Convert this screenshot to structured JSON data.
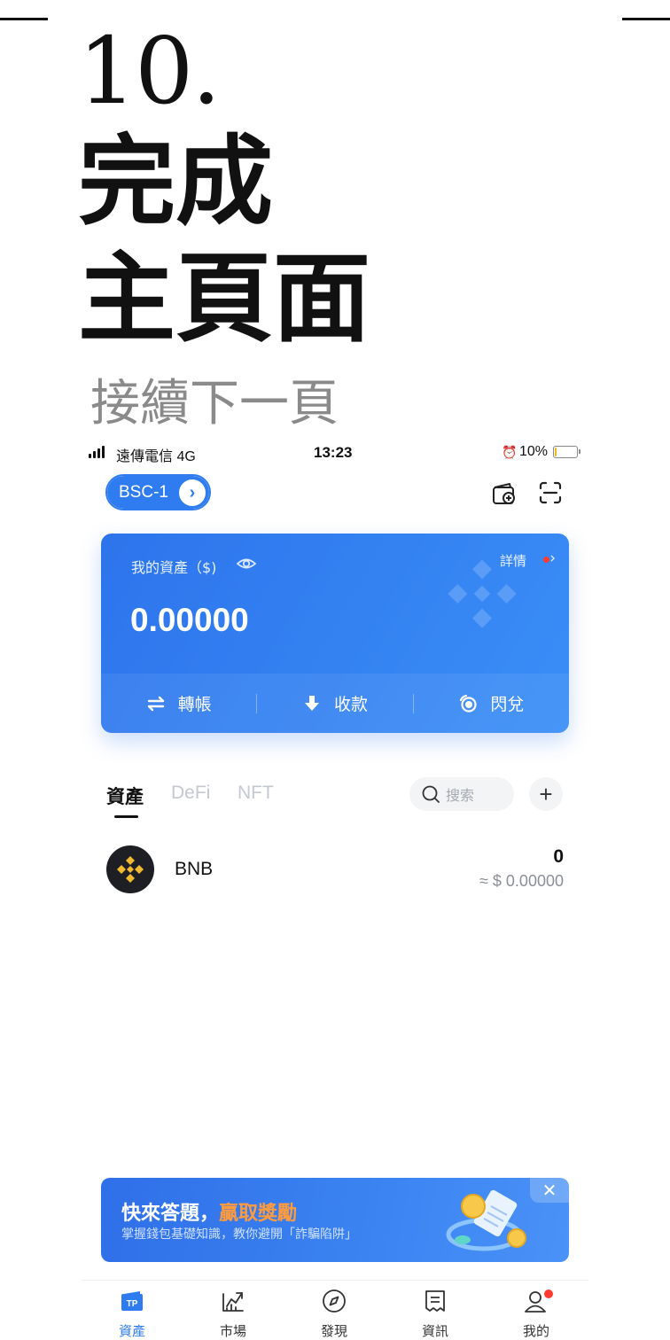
{
  "slide": {
    "step_number": "10.",
    "title_line_1": "完成",
    "title_line_2": "主頁面",
    "continue_note": "接續下一頁"
  },
  "status_bar": {
    "carrier": "遠傳電信  4G",
    "time": "13:23",
    "battery_percent": "10%",
    "battery_level": 0.1
  },
  "header": {
    "chain_name": "BSC-1",
    "chain_arrow": "›",
    "icons": [
      "wallet-add-icon",
      "scan-icon"
    ]
  },
  "asset_card": {
    "label": "我的資產（$)",
    "details": "詳情",
    "balance": "0.00000",
    "actions": [
      {
        "label": "轉帳",
        "icon": "transfer-icon"
      },
      {
        "label": "收款",
        "icon": "receive-icon"
      },
      {
        "label": "閃兌",
        "icon": "swap-icon"
      }
    ]
  },
  "tabs": [
    {
      "label": "資產",
      "active": true
    },
    {
      "label": "DeFi",
      "active": false
    },
    {
      "label": "NFT",
      "active": false
    }
  ],
  "search": {
    "placeholder": "搜索"
  },
  "add_button": "+",
  "tokens": [
    {
      "symbol": "BNB",
      "amount": "0",
      "value": "≈ $ 0.00000",
      "icon": "bnb-logo-icon"
    }
  ],
  "promo": {
    "title_prefix": "快來答題，",
    "title_accent": "贏取獎勵",
    "subtitle": "掌握錢包基礎知識，教你避開「詐騙陷阱」",
    "close": "✕"
  },
  "bottom_nav": [
    {
      "label": "資產",
      "icon": "tp-wallet-icon",
      "active": true
    },
    {
      "label": "市場",
      "icon": "market-chart-icon",
      "active": false
    },
    {
      "label": "發現",
      "icon": "compass-icon",
      "active": false
    },
    {
      "label": "資訊",
      "icon": "news-icon",
      "active": false
    },
    {
      "label": "我的",
      "icon": "profile-icon",
      "active": false
    }
  ],
  "colors": {
    "brand_blue": "#2f7bf0",
    "accent_orange": "#ff9b3d",
    "notification_red": "#ff3b30",
    "bnb_yellow": "#f3ba2f"
  }
}
